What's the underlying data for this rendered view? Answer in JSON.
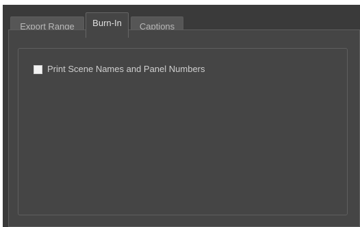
{
  "tabs": [
    {
      "label": "Export Range",
      "active": false
    },
    {
      "label": "Burn-In",
      "active": true
    },
    {
      "label": "Captions",
      "active": false
    }
  ],
  "burn_in": {
    "print_scene_names_label": "Print Scene Names and Panel Numbers",
    "print_scene_names_checked": false
  },
  "colors": {
    "window_bg": "#3a3a3a",
    "panel_bg": "#454545",
    "tab_bg": "#565656",
    "text": "#cfcfcf",
    "checkbox_bg": "#f2f2f2"
  }
}
